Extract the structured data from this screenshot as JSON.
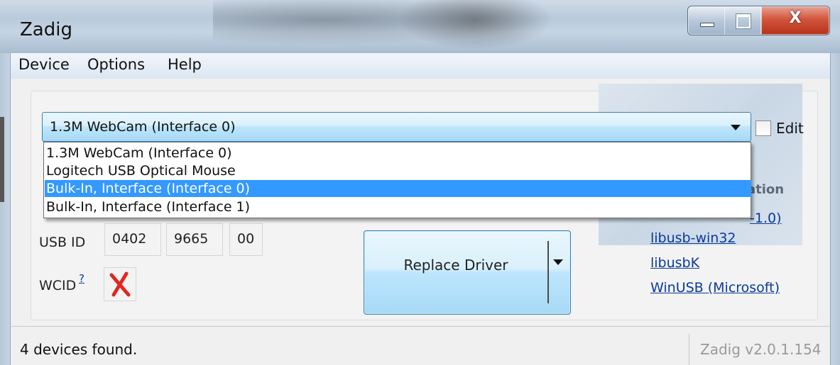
{
  "window": {
    "title": "Zadig",
    "controls": {
      "minimize_icon": "minimize-icon",
      "maximize_icon": "maximize-icon",
      "close_glyph": "X"
    }
  },
  "menu": {
    "items": [
      "Device",
      "Options",
      "Help"
    ]
  },
  "device_combo": {
    "selected": "1.3M WebCam (Interface 0)",
    "arrow_icon": "chevron-down-icon",
    "options": [
      "1.3M WebCam (Interface 0)",
      "Logitech USB Optical Mouse",
      "Bulk-In, Interface (Interface 0)",
      "Bulk-In, Interface (Interface 1)"
    ],
    "highlighted_index": 2
  },
  "edit": {
    "label": "Edit",
    "checked": false
  },
  "usb_id": {
    "label": "USB ID",
    "vid": "0402",
    "pid": "9665",
    "mi": "00"
  },
  "wcid": {
    "label": "WCID",
    "help_mark": "?",
    "status_icon": "red-x-icon",
    "status_color": "#e0281e"
  },
  "replace_button": {
    "label": "Replace Driver",
    "arrow_icon": "chevron-down-icon"
  },
  "info_panel": {
    "title_fragment": "ation",
    "links": [
      "-1.0)",
      "libusb-win32",
      "libusbK",
      "WinUSB (Microsoft)"
    ]
  },
  "status": {
    "left": "4 devices found.",
    "right": "Zadig v2.0.1.154"
  },
  "colors": {
    "selection": "#3399ff",
    "link": "#0a3a9c",
    "button_border": "#3c7fb1"
  }
}
